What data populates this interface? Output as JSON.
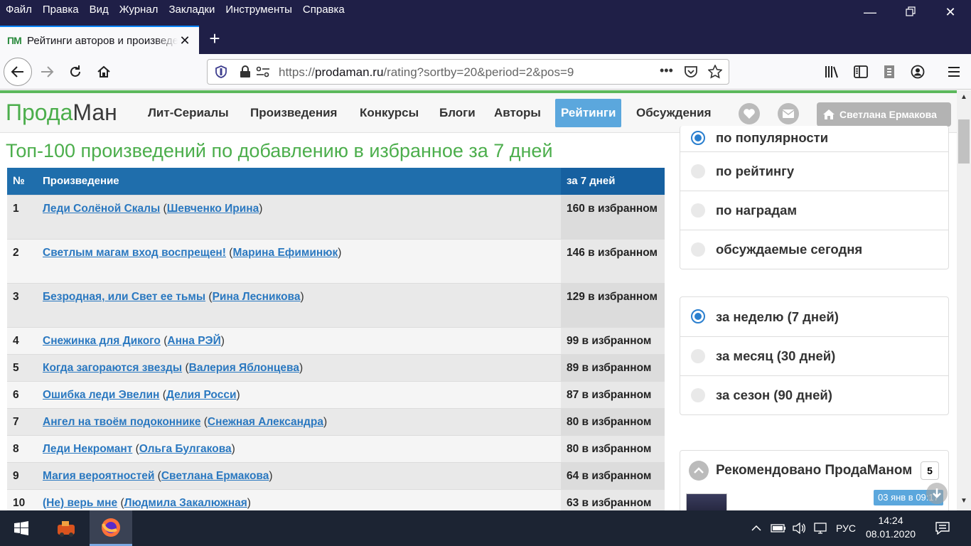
{
  "menubar": [
    "Файл",
    "Правка",
    "Вид",
    "Журнал",
    "Закладки",
    "Инструменты",
    "Справка"
  ],
  "tab": {
    "favicon": "ПМ",
    "title": "Рейтинги авторов и произведений"
  },
  "url": {
    "prefix": "https://",
    "host": "prodaman.ru",
    "path": "/rating?sortby=20&period=2&pos=9"
  },
  "site": {
    "logo_green": "Прода",
    "logo_dark": "Ман",
    "nav": [
      "Лит-Сериалы",
      "Произведения",
      "Конкурсы",
      "Блоги",
      "Авторы",
      "Рейтинги",
      "Обсуждения"
    ],
    "user": "Светлана Ермакова"
  },
  "heading": "Топ-100 произведений по добавлению в избранное за 7 дней",
  "table": {
    "headers": [
      "№",
      "Произведение",
      "за 7 дней"
    ],
    "rows": [
      {
        "n": "1",
        "title": "Леди Солёной Скалы",
        "author": "Шевченко Ирина",
        "count": "160 в избранном"
      },
      {
        "n": "2",
        "title": "Светлым магам вход воспрещен!",
        "author": "Марина Ефиминюк",
        "count": "146 в избранном"
      },
      {
        "n": "3",
        "title": "Безродная, или Свет ее тьмы",
        "author": "Рина Лесникова",
        "count": "129 в избранном"
      },
      {
        "n": "4",
        "title": "Снежинка для Дикого",
        "author": "Анна РЭЙ",
        "count": "99 в избранном"
      },
      {
        "n": "5",
        "title": "Когда загораются звезды",
        "author": "Валерия Яблонцева",
        "count": "89 в избранном"
      },
      {
        "n": "6",
        "title": "Ошибка леди Эвелин",
        "author": "Делия Росси",
        "count": "87 в избранном"
      },
      {
        "n": "7",
        "title": "Ангел на твоём подоконнике",
        "author": "Снежная Александра",
        "count": "80 в избранном"
      },
      {
        "n": "8",
        "title": "Леди Некромант",
        "author": "Ольга Булгакова",
        "count": "80 в избранном"
      },
      {
        "n": "9",
        "title": "Магия вероятностей",
        "author": "Светлана Ермакова",
        "count": "64 в избранном"
      },
      {
        "n": "10",
        "title": "(Не) верь мне",
        "author": "Людмила Закалюжная",
        "count": "63 в избранном"
      }
    ]
  },
  "sort_panel": {
    "options": [
      "по популярности",
      "по рейтингу",
      "по наградам",
      "обсуждаемые сегодня"
    ],
    "selected": 0
  },
  "period_panel": {
    "options": [
      "за неделю (7 дней)",
      "за месяц (30 дней)",
      "за сезон (90 дней)"
    ],
    "selected": 0
  },
  "recommended": {
    "title": "Рекомендовано ПродаМаном",
    "count": "5",
    "date": "03 янв в 09:17"
  },
  "taskbar": {
    "lang": "РУС",
    "time": "14:24",
    "date": "08.01.2020"
  },
  "colors": {
    "accent_green": "#4cae4c",
    "table_header": "#1f6eac",
    "link": "#2a78c0",
    "active_nav": "#5ba7dd"
  }
}
